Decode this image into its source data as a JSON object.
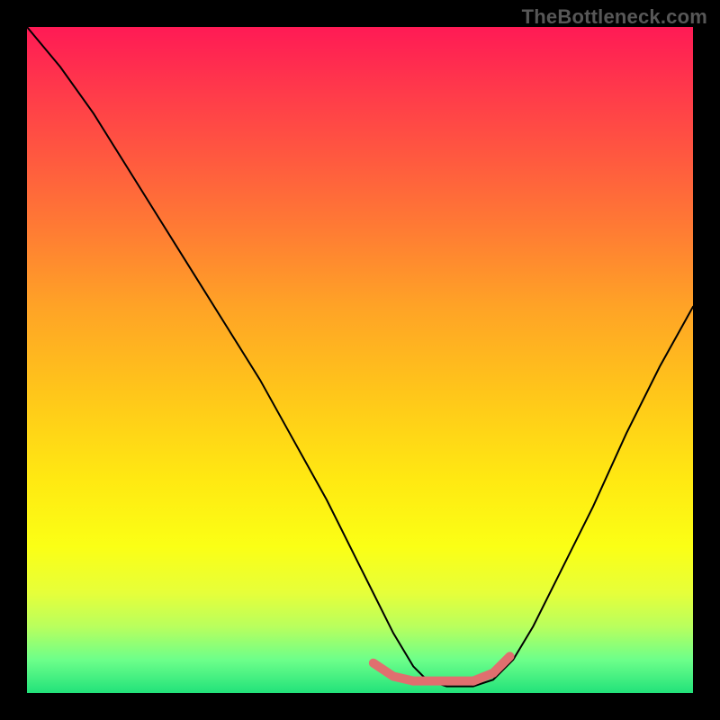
{
  "watermark": "TheBottleneck.com",
  "colors": {
    "marker": "#e06f6f",
    "curve": "#000000",
    "background": "#000000"
  },
  "chart_data": {
    "type": "line",
    "title": "",
    "xlabel": "",
    "ylabel": "",
    "xlim": [
      0,
      100
    ],
    "ylim": [
      0,
      100
    ],
    "grid": false,
    "legend": false,
    "series": [
      {
        "name": "bottleneck-curve",
        "x": [
          0,
          5,
          10,
          15,
          20,
          25,
          30,
          35,
          40,
          45,
          50,
          52,
          55,
          58,
          60,
          63,
          67,
          70,
          73,
          76,
          80,
          85,
          90,
          95,
          100
        ],
        "y": [
          100,
          94,
          87,
          79,
          71,
          63,
          55,
          47,
          38,
          29,
          19,
          15,
          9,
          4,
          2,
          1,
          1,
          2,
          5,
          10,
          18,
          28,
          39,
          49,
          58
        ]
      }
    ],
    "markers": [
      {
        "name": "optimum-segment-1",
        "x": [
          52,
          55
        ],
        "y": [
          4.5,
          2.5
        ]
      },
      {
        "name": "optimum-segment-2",
        "x": [
          55,
          58
        ],
        "y": [
          2.5,
          1.8
        ]
      },
      {
        "name": "optimum-segment-3",
        "x": [
          58,
          67
        ],
        "y": [
          1.8,
          1.8
        ]
      },
      {
        "name": "optimum-segment-4",
        "x": [
          67,
          70
        ],
        "y": [
          1.8,
          3.0
        ]
      },
      {
        "name": "optimum-segment-5",
        "x": [
          70,
          72.5
        ],
        "y": [
          3.0,
          5.5
        ]
      }
    ]
  }
}
